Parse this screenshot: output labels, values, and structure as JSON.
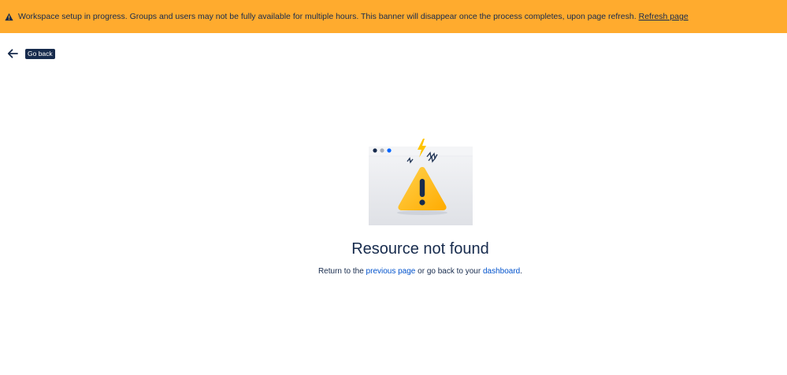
{
  "banner": {
    "message": "Workspace setup in progress. Groups and users may not be fully available for multiple hours. This banner will disappear once the process completes, upon page refresh.",
    "action_label": "Refresh page",
    "icon": "warning-icon",
    "background_color": "#FFAB2E"
  },
  "nav": {
    "back_icon": "arrow-left-icon",
    "back_tooltip": "Go back"
  },
  "error": {
    "illustration": "warning-illustration",
    "title": "Resource not found",
    "desc_prefix": "Return to the",
    "previous_link": "previous page",
    "desc_middle": "or go back to your",
    "dashboard_link": "dashboard",
    "desc_suffix": "."
  },
  "colors": {
    "text": "#172B4D",
    "link": "#0052CC",
    "warning_yellow": "#FFC400"
  }
}
